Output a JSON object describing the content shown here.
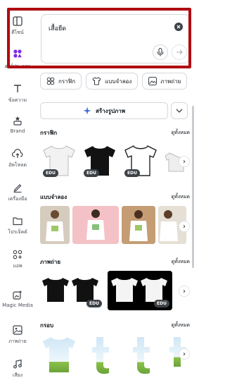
{
  "rail": {
    "items": [
      {
        "label": "ดีไซน์",
        "icon": "layout-icon"
      },
      {
        "label": "องค์ประกอบ",
        "icon": "elements-icon"
      },
      {
        "label": "ข้อความ",
        "icon": "text-icon"
      },
      {
        "label": "Brand",
        "icon": "brand-icon"
      },
      {
        "label": "อัพโหลด",
        "icon": "upload-icon"
      },
      {
        "label": "เครื่องมือ",
        "icon": "draw-icon"
      },
      {
        "label": "โปรเจ็คต์",
        "icon": "folder-icon"
      },
      {
        "label": "แอพ",
        "icon": "apps-icon"
      },
      {
        "label": "Magic Media",
        "icon": "magic-media-icon"
      },
      {
        "label": "ภาพถ่าย",
        "icon": "photo-icon"
      },
      {
        "label": "เสียง",
        "icon": "audio-icon"
      }
    ]
  },
  "search": {
    "value": "เสื้อยืด"
  },
  "chips": [
    {
      "label": "กราฟิก",
      "icon": "shapes-icon"
    },
    {
      "label": "แบบจำลอง",
      "icon": "tshirt-icon"
    },
    {
      "label": "ภาพถ่าย",
      "icon": "photo-icon"
    }
  ],
  "create": {
    "label": "สร้างรูปภาพ"
  },
  "sections": [
    {
      "title": "กราฟิก",
      "link": "ดูทั้งหมด"
    },
    {
      "title": "แบบจำลอง",
      "link": "ดูทั้งหมด"
    },
    {
      "title": "ภาพถ่าย",
      "link": "ดูทั้งหมด"
    },
    {
      "title": "กรอบ",
      "link": "ดูทั้งหมด"
    }
  ],
  "badge": "EDU",
  "colors": {
    "highlight": "#b10a10",
    "accent": "#7d2ae8"
  }
}
